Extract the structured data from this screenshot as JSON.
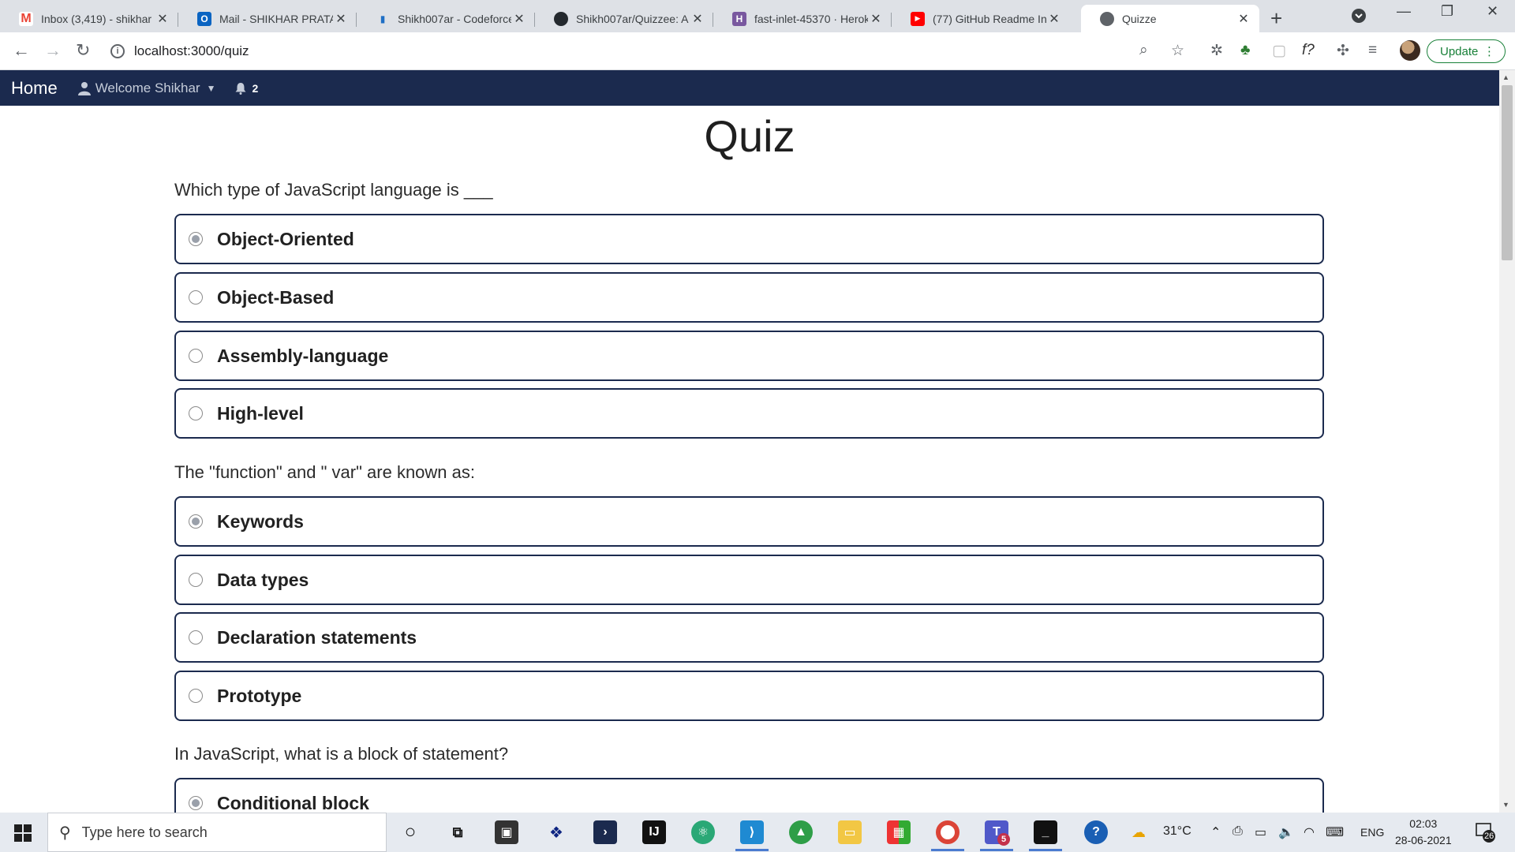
{
  "browser": {
    "tabs": [
      {
        "title": "Inbox (3,419) - shikhar",
        "icon": "gmail-icon",
        "color": "#ea4335",
        "glyph": "M"
      },
      {
        "title": "Mail - SHIKHAR PRATAP",
        "icon": "outlook-icon",
        "color": "#0a64c2",
        "glyph": "O"
      },
      {
        "title": "Shikh007ar - Codeforces",
        "icon": "codeforces-icon",
        "color": "#1f6fc5",
        "glyph": "▮"
      },
      {
        "title": "Shikh007ar/Quizzee: A",
        "icon": "github-icon",
        "color": "#24292e",
        "glyph": "●"
      },
      {
        "title": "fast-inlet-45370 · Heroku",
        "icon": "heroku-icon",
        "color": "#79589f",
        "glyph": "H"
      },
      {
        "title": "(77) GitHub Readme In",
        "icon": "youtube-icon",
        "color": "#ff0000",
        "glyph": "▶"
      },
      {
        "title": "Quizze",
        "icon": "globe-icon",
        "color": "#5f6368",
        "glyph": "◍"
      }
    ],
    "url": "localhost:3000/quiz",
    "update_label": "Update"
  },
  "navbar": {
    "brand": "Home",
    "welcome": "Welcome Shikhar",
    "notifications": "2"
  },
  "quiz": {
    "title": "Quiz",
    "questions": [
      {
        "text": "Which type of JavaScript language is ___",
        "options": [
          "Object-Oriented",
          "Object-Based",
          "Assembly-language",
          "High-level"
        ],
        "selected": 0
      },
      {
        "text": "The \"function\" and \" var\" are known as:",
        "options": [
          "Keywords",
          "Data types",
          "Declaration statements",
          "Prototype"
        ],
        "selected": 0
      },
      {
        "text": "In JavaScript, what is a block of statement?",
        "options": [
          "Conditional block"
        ],
        "selected": 0
      }
    ]
  },
  "taskbar": {
    "search_placeholder": "Type here to search",
    "weather": "31°C",
    "language": "ENG",
    "time": "02:03",
    "date": "28-06-2021",
    "notification_count": "26",
    "teams_badge": "5"
  }
}
